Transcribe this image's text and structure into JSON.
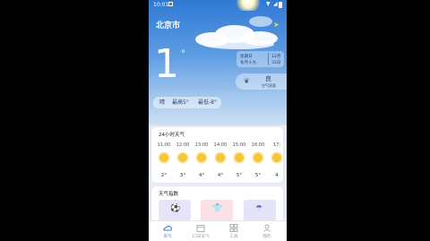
{
  "status_bar": {
    "time": "10:01"
  },
  "header": {
    "city": "北京市"
  },
  "current": {
    "temperature": "1",
    "degree_symbol": "°",
    "condition": "晴",
    "high_label": "最高5°",
    "low_label": "最低-8°"
  },
  "date_info": {
    "weekday": "星期日",
    "lunar": "冬月十九",
    "month": "12月",
    "day": "31日"
  },
  "air_quality": {
    "level": "良",
    "label": "空气质量"
  },
  "hourly": {
    "title": "24小时天气",
    "hours": [
      {
        "time": "11:00",
        "temp": "2°",
        "icon": "sun-icon"
      },
      {
        "time": "12:00",
        "temp": "3°",
        "icon": "sun-icon"
      },
      {
        "time": "13:00",
        "temp": "4°",
        "icon": "sun-icon"
      },
      {
        "time": "14:00",
        "temp": "4°",
        "icon": "sun-icon"
      },
      {
        "time": "15:00",
        "temp": "5°",
        "icon": "sun-icon"
      },
      {
        "time": "16:00",
        "temp": "5°",
        "icon": "sun-icon"
      },
      {
        "time": "17:",
        "temp": "4",
        "icon": "sun-icon"
      }
    ]
  },
  "index": {
    "title": "天气指数",
    "tiles": [
      {
        "icon": "sport-icon",
        "color": "#e7e3f8"
      },
      {
        "icon": "clothing-icon",
        "color": "#fbe1e6"
      },
      {
        "icon": "umbrella-icon",
        "color": "#e4e3f8"
      }
    ]
  },
  "tabs": [
    {
      "label": "天气",
      "icon": "weather-tab-icon",
      "active": true
    },
    {
      "label": "15日天气",
      "icon": "calendar-tab-icon",
      "active": false
    },
    {
      "label": "工具",
      "icon": "tools-tab-icon",
      "active": false
    },
    {
      "label": "我的",
      "icon": "profile-tab-icon",
      "active": false
    }
  ],
  "colors": {
    "accent": "#3a78d8",
    "inactive": "#9a9a9a",
    "sun": "#f5c53a"
  }
}
